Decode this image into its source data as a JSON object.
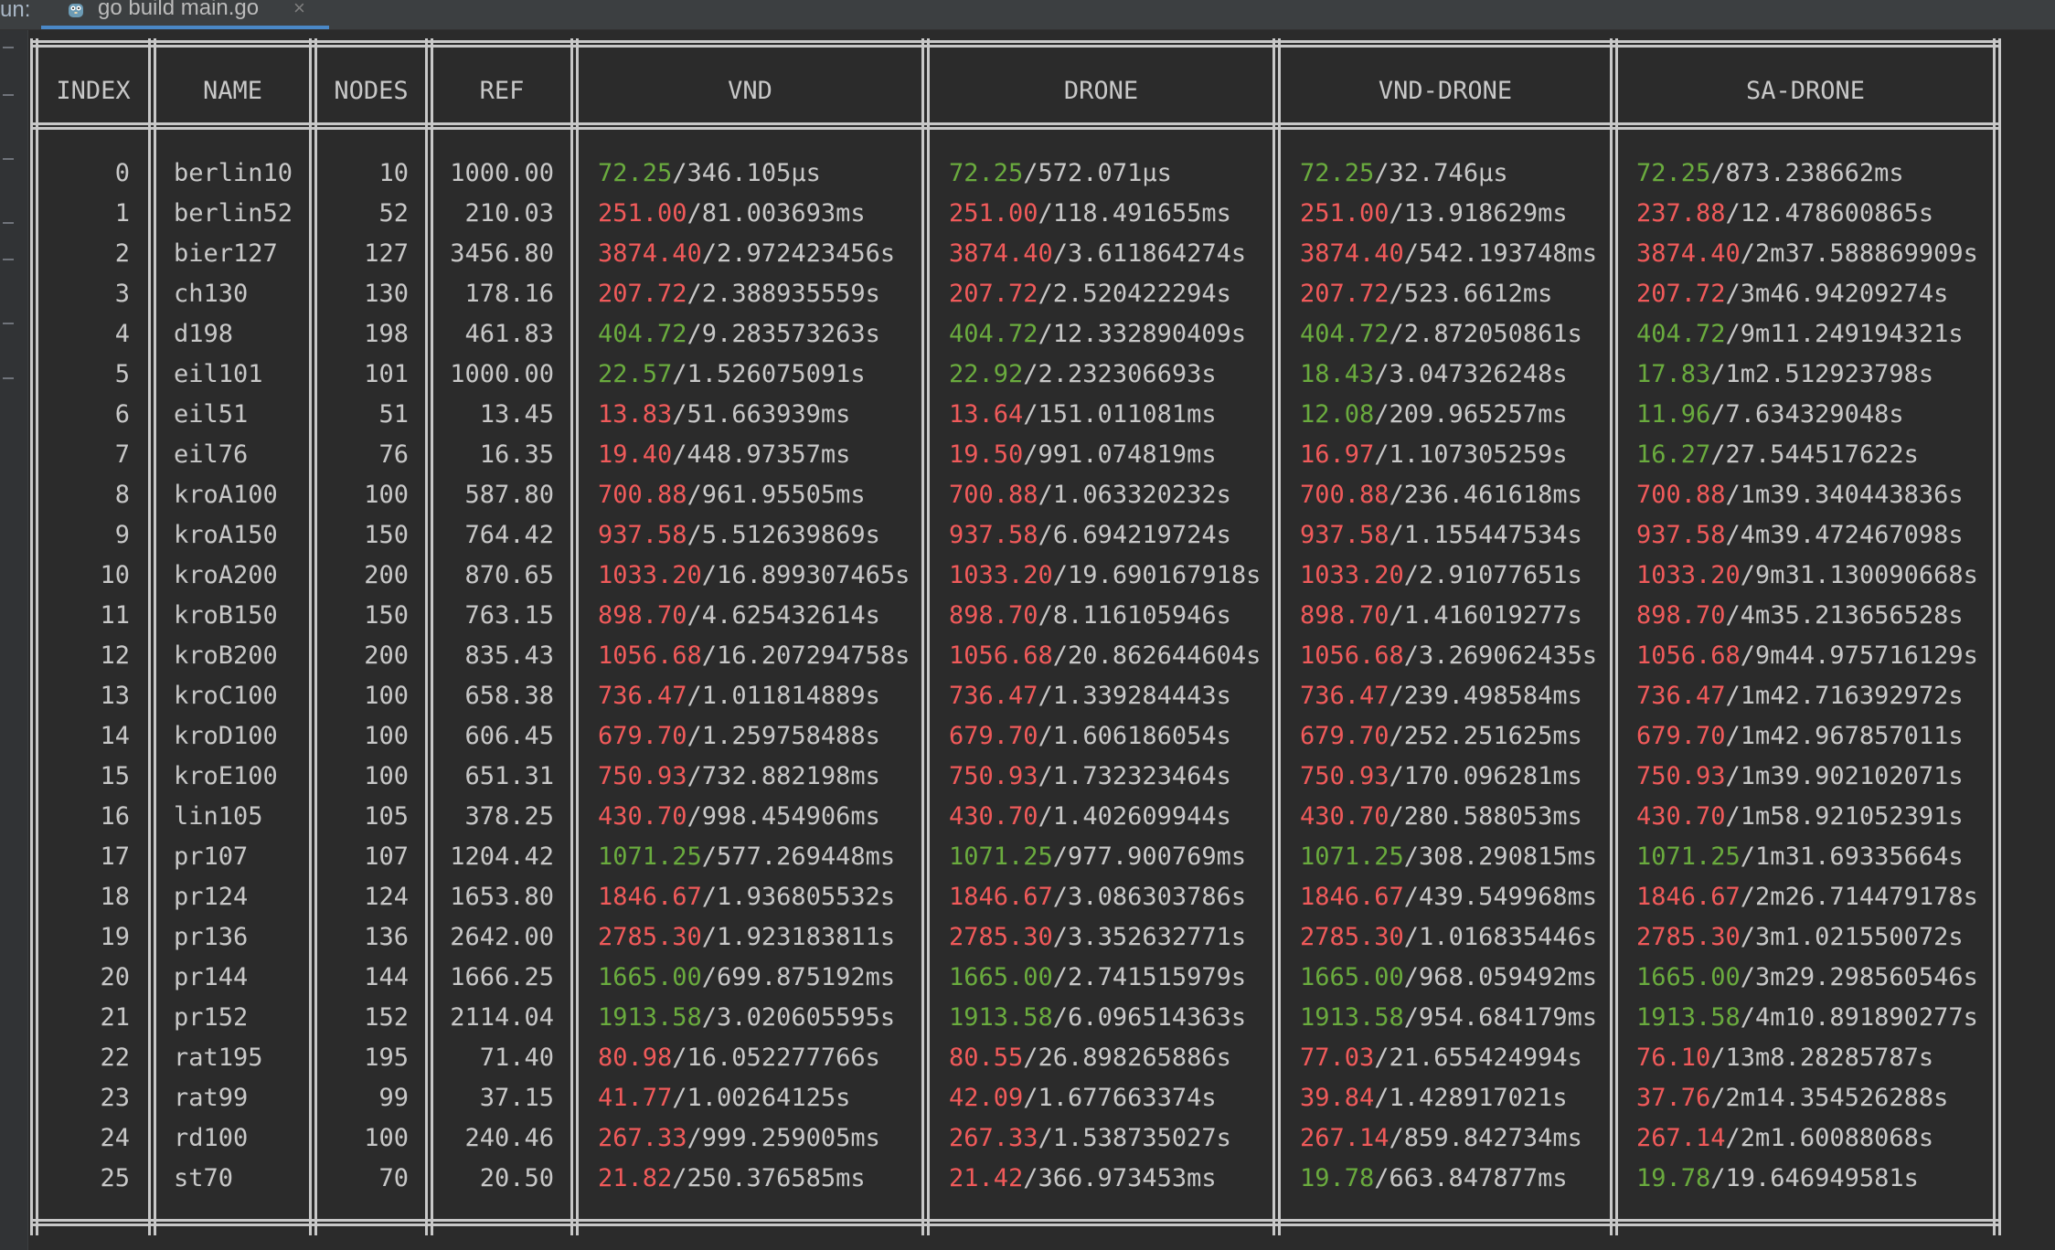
{
  "run_bar": {
    "label": "un:",
    "tab_title": "go build main.go",
    "tab_close": "×",
    "tab_icon": "go-gopher-icon"
  },
  "colors": {
    "background": "#2b2b2b",
    "text": "#c8c8c8",
    "good": "#6aab3e",
    "bad": "#f05a5a",
    "tab_underline": "#4a88c7"
  },
  "table": {
    "headers": [
      "INDEX",
      "NAME",
      "NODES",
      "REF",
      "VND",
      "DRONE",
      "VND-DRONE",
      "SA-DRONE"
    ],
    "rows": [
      {
        "index": "0",
        "name": "berlin10",
        "nodes": "10",
        "ref": "1000.00",
        "vnd": {
          "cost": "72.25",
          "time": "/346.105µs",
          "good": true
        },
        "drone": {
          "cost": "72.25",
          "time": "/572.071µs",
          "good": true
        },
        "vnd_drone": {
          "cost": "72.25",
          "time": "/32.746µs",
          "good": true
        },
        "sa_drone": {
          "cost": "72.25",
          "time": "/873.238662ms",
          "good": true
        }
      },
      {
        "index": "1",
        "name": "berlin52",
        "nodes": "52",
        "ref": "210.03",
        "vnd": {
          "cost": "251.00",
          "time": "/81.003693ms",
          "good": false
        },
        "drone": {
          "cost": "251.00",
          "time": "/118.491655ms",
          "good": false
        },
        "vnd_drone": {
          "cost": "251.00",
          "time": "/13.918629ms",
          "good": false
        },
        "sa_drone": {
          "cost": "237.88",
          "time": "/12.478600865s",
          "good": false
        }
      },
      {
        "index": "2",
        "name": "bier127",
        "nodes": "127",
        "ref": "3456.80",
        "vnd": {
          "cost": "3874.40",
          "time": "/2.972423456s",
          "good": false
        },
        "drone": {
          "cost": "3874.40",
          "time": "/3.611864274s",
          "good": false
        },
        "vnd_drone": {
          "cost": "3874.40",
          "time": "/542.193748ms",
          "good": false
        },
        "sa_drone": {
          "cost": "3874.40",
          "time": "/2m37.588869909s",
          "good": false
        }
      },
      {
        "index": "3",
        "name": "ch130",
        "nodes": "130",
        "ref": "178.16",
        "vnd": {
          "cost": "207.72",
          "time": "/2.388935559s",
          "good": false
        },
        "drone": {
          "cost": "207.72",
          "time": "/2.520422294s",
          "good": false
        },
        "vnd_drone": {
          "cost": "207.72",
          "time": "/523.6612ms",
          "good": false
        },
        "sa_drone": {
          "cost": "207.72",
          "time": "/3m46.94209274s",
          "good": false
        }
      },
      {
        "index": "4",
        "name": "d198",
        "nodes": "198",
        "ref": "461.83",
        "vnd": {
          "cost": "404.72",
          "time": "/9.283573263s",
          "good": true
        },
        "drone": {
          "cost": "404.72",
          "time": "/12.332890409s",
          "good": true
        },
        "vnd_drone": {
          "cost": "404.72",
          "time": "/2.872050861s",
          "good": true
        },
        "sa_drone": {
          "cost": "404.72",
          "time": "/9m11.249194321s",
          "good": true
        }
      },
      {
        "index": "5",
        "name": "eil101",
        "nodes": "101",
        "ref": "1000.00",
        "vnd": {
          "cost": "22.57",
          "time": "/1.526075091s",
          "good": true
        },
        "drone": {
          "cost": "22.92",
          "time": "/2.232306693s",
          "good": true
        },
        "vnd_drone": {
          "cost": "18.43",
          "time": "/3.047326248s",
          "good": true
        },
        "sa_drone": {
          "cost": "17.83",
          "time": "/1m2.512923798s",
          "good": true
        }
      },
      {
        "index": "6",
        "name": "eil51",
        "nodes": "51",
        "ref": "13.45",
        "vnd": {
          "cost": "13.83",
          "time": "/51.663939ms",
          "good": false
        },
        "drone": {
          "cost": "13.64",
          "time": "/151.011081ms",
          "good": false
        },
        "vnd_drone": {
          "cost": "12.08",
          "time": "/209.965257ms",
          "good": true
        },
        "sa_drone": {
          "cost": "11.96",
          "time": "/7.634329048s",
          "good": true
        }
      },
      {
        "index": "7",
        "name": "eil76",
        "nodes": "76",
        "ref": "16.35",
        "vnd": {
          "cost": "19.40",
          "time": "/448.97357ms",
          "good": false
        },
        "drone": {
          "cost": "19.50",
          "time": "/991.074819ms",
          "good": false
        },
        "vnd_drone": {
          "cost": "16.97",
          "time": "/1.107305259s",
          "good": false
        },
        "sa_drone": {
          "cost": "16.27",
          "time": "/27.544517622s",
          "good": true
        }
      },
      {
        "index": "8",
        "name": "kroA100",
        "nodes": "100",
        "ref": "587.80",
        "vnd": {
          "cost": "700.88",
          "time": "/961.95505ms",
          "good": false
        },
        "drone": {
          "cost": "700.88",
          "time": "/1.063320232s",
          "good": false
        },
        "vnd_drone": {
          "cost": "700.88",
          "time": "/236.461618ms",
          "good": false
        },
        "sa_drone": {
          "cost": "700.88",
          "time": "/1m39.340443836s",
          "good": false
        }
      },
      {
        "index": "9",
        "name": "kroA150",
        "nodes": "150",
        "ref": "764.42",
        "vnd": {
          "cost": "937.58",
          "time": "/5.512639869s",
          "good": false
        },
        "drone": {
          "cost": "937.58",
          "time": "/6.694219724s",
          "good": false
        },
        "vnd_drone": {
          "cost": "937.58",
          "time": "/1.155447534s",
          "good": false
        },
        "sa_drone": {
          "cost": "937.58",
          "time": "/4m39.472467098s",
          "good": false
        }
      },
      {
        "index": "10",
        "name": "kroA200",
        "nodes": "200",
        "ref": "870.65",
        "vnd": {
          "cost": "1033.20",
          "time": "/16.899307465s",
          "good": false
        },
        "drone": {
          "cost": "1033.20",
          "time": "/19.690167918s",
          "good": false
        },
        "vnd_drone": {
          "cost": "1033.20",
          "time": "/2.91077651s",
          "good": false
        },
        "sa_drone": {
          "cost": "1033.20",
          "time": "/9m31.130090668s",
          "good": false
        }
      },
      {
        "index": "11",
        "name": "kroB150",
        "nodes": "150",
        "ref": "763.15",
        "vnd": {
          "cost": "898.70",
          "time": "/4.625432614s",
          "good": false
        },
        "drone": {
          "cost": "898.70",
          "time": "/8.116105946s",
          "good": false
        },
        "vnd_drone": {
          "cost": "898.70",
          "time": "/1.416019277s",
          "good": false
        },
        "sa_drone": {
          "cost": "898.70",
          "time": "/4m35.213656528s",
          "good": false
        }
      },
      {
        "index": "12",
        "name": "kroB200",
        "nodes": "200",
        "ref": "835.43",
        "vnd": {
          "cost": "1056.68",
          "time": "/16.207294758s",
          "good": false
        },
        "drone": {
          "cost": "1056.68",
          "time": "/20.862644604s",
          "good": false
        },
        "vnd_drone": {
          "cost": "1056.68",
          "time": "/3.269062435s",
          "good": false
        },
        "sa_drone": {
          "cost": "1056.68",
          "time": "/9m44.975716129s",
          "good": false
        }
      },
      {
        "index": "13",
        "name": "kroC100",
        "nodes": "100",
        "ref": "658.38",
        "vnd": {
          "cost": "736.47",
          "time": "/1.011814889s",
          "good": false
        },
        "drone": {
          "cost": "736.47",
          "time": "/1.339284443s",
          "good": false
        },
        "vnd_drone": {
          "cost": "736.47",
          "time": "/239.498584ms",
          "good": false
        },
        "sa_drone": {
          "cost": "736.47",
          "time": "/1m42.716392972s",
          "good": false
        }
      },
      {
        "index": "14",
        "name": "kroD100",
        "nodes": "100",
        "ref": "606.45",
        "vnd": {
          "cost": "679.70",
          "time": "/1.259758488s",
          "good": false
        },
        "drone": {
          "cost": "679.70",
          "time": "/1.606186054s",
          "good": false
        },
        "vnd_drone": {
          "cost": "679.70",
          "time": "/252.251625ms",
          "good": false
        },
        "sa_drone": {
          "cost": "679.70",
          "time": "/1m42.967857011s",
          "good": false
        }
      },
      {
        "index": "15",
        "name": "kroE100",
        "nodes": "100",
        "ref": "651.31",
        "vnd": {
          "cost": "750.93",
          "time": "/732.882198ms",
          "good": false
        },
        "drone": {
          "cost": "750.93",
          "time": "/1.732323464s",
          "good": false
        },
        "vnd_drone": {
          "cost": "750.93",
          "time": "/170.096281ms",
          "good": false
        },
        "sa_drone": {
          "cost": "750.93",
          "time": "/1m39.902102071s",
          "good": false
        }
      },
      {
        "index": "16",
        "name": "lin105",
        "nodes": "105",
        "ref": "378.25",
        "vnd": {
          "cost": "430.70",
          "time": "/998.454906ms",
          "good": false
        },
        "drone": {
          "cost": "430.70",
          "time": "/1.402609944s",
          "good": false
        },
        "vnd_drone": {
          "cost": "430.70",
          "time": "/280.588053ms",
          "good": false
        },
        "sa_drone": {
          "cost": "430.70",
          "time": "/1m58.921052391s",
          "good": false
        }
      },
      {
        "index": "17",
        "name": "pr107",
        "nodes": "107",
        "ref": "1204.42",
        "vnd": {
          "cost": "1071.25",
          "time": "/577.269448ms",
          "good": true
        },
        "drone": {
          "cost": "1071.25",
          "time": "/977.900769ms",
          "good": true
        },
        "vnd_drone": {
          "cost": "1071.25",
          "time": "/308.290815ms",
          "good": true
        },
        "sa_drone": {
          "cost": "1071.25",
          "time": "/1m31.69335664s",
          "good": true
        }
      },
      {
        "index": "18",
        "name": "pr124",
        "nodes": "124",
        "ref": "1653.80",
        "vnd": {
          "cost": "1846.67",
          "time": "/1.936805532s",
          "good": false
        },
        "drone": {
          "cost": "1846.67",
          "time": "/3.086303786s",
          "good": false
        },
        "vnd_drone": {
          "cost": "1846.67",
          "time": "/439.549968ms",
          "good": false
        },
        "sa_drone": {
          "cost": "1846.67",
          "time": "/2m26.714479178s",
          "good": false
        }
      },
      {
        "index": "19",
        "name": "pr136",
        "nodes": "136",
        "ref": "2642.00",
        "vnd": {
          "cost": "2785.30",
          "time": "/1.923183811s",
          "good": false
        },
        "drone": {
          "cost": "2785.30",
          "time": "/3.352632771s",
          "good": false
        },
        "vnd_drone": {
          "cost": "2785.30",
          "time": "/1.016835446s",
          "good": false
        },
        "sa_drone": {
          "cost": "2785.30",
          "time": "/3m1.021550072s",
          "good": false
        }
      },
      {
        "index": "20",
        "name": "pr144",
        "nodes": "144",
        "ref": "1666.25",
        "vnd": {
          "cost": "1665.00",
          "time": "/699.875192ms",
          "good": true
        },
        "drone": {
          "cost": "1665.00",
          "time": "/2.741515979s",
          "good": true
        },
        "vnd_drone": {
          "cost": "1665.00",
          "time": "/968.059492ms",
          "good": true
        },
        "sa_drone": {
          "cost": "1665.00",
          "time": "/3m29.298560546s",
          "good": true
        }
      },
      {
        "index": "21",
        "name": "pr152",
        "nodes": "152",
        "ref": "2114.04",
        "vnd": {
          "cost": "1913.58",
          "time": "/3.020605595s",
          "good": true
        },
        "drone": {
          "cost": "1913.58",
          "time": "/6.096514363s",
          "good": true
        },
        "vnd_drone": {
          "cost": "1913.58",
          "time": "/954.684179ms",
          "good": true
        },
        "sa_drone": {
          "cost": "1913.58",
          "time": "/4m10.891890277s",
          "good": true
        }
      },
      {
        "index": "22",
        "name": "rat195",
        "nodes": "195",
        "ref": "71.40",
        "vnd": {
          "cost": "80.98",
          "time": "/16.052277766s",
          "good": false
        },
        "drone": {
          "cost": "80.55",
          "time": "/26.898265886s",
          "good": false
        },
        "vnd_drone": {
          "cost": "77.03",
          "time": "/21.655424994s",
          "good": false
        },
        "sa_drone": {
          "cost": "76.10",
          "time": "/13m8.28285787s",
          "good": false
        }
      },
      {
        "index": "23",
        "name": "rat99",
        "nodes": "99",
        "ref": "37.15",
        "vnd": {
          "cost": "41.77",
          "time": "/1.00264125s",
          "good": false
        },
        "drone": {
          "cost": "42.09",
          "time": "/1.677663374s",
          "good": false
        },
        "vnd_drone": {
          "cost": "39.84",
          "time": "/1.428917021s",
          "good": false
        },
        "sa_drone": {
          "cost": "37.76",
          "time": "/2m14.354526288s",
          "good": false
        }
      },
      {
        "index": "24",
        "name": "rd100",
        "nodes": "100",
        "ref": "240.46",
        "vnd": {
          "cost": "267.33",
          "time": "/999.259005ms",
          "good": false
        },
        "drone": {
          "cost": "267.33",
          "time": "/1.538735027s",
          "good": false
        },
        "vnd_drone": {
          "cost": "267.14",
          "time": "/859.842734ms",
          "good": false
        },
        "sa_drone": {
          "cost": "267.14",
          "time": "/2m1.60088068s",
          "good": false
        }
      },
      {
        "index": "25",
        "name": "st70",
        "nodes": "70",
        "ref": "20.50",
        "vnd": {
          "cost": "21.82",
          "time": "/250.376585ms",
          "good": false
        },
        "drone": {
          "cost": "21.42",
          "time": "/366.973453ms",
          "good": false
        },
        "vnd_drone": {
          "cost": "19.78",
          "time": "/663.847877ms",
          "good": true
        },
        "sa_drone": {
          "cost": "19.78",
          "time": "/19.646949581s",
          "good": true
        }
      }
    ]
  }
}
